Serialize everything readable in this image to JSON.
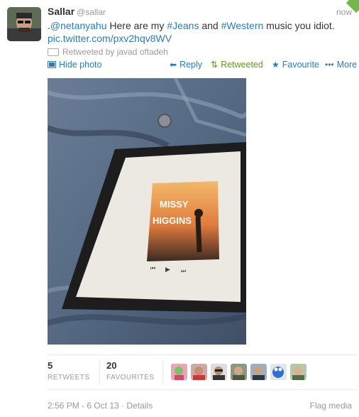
{
  "tweet": {
    "name": "Sallar",
    "handle": "@sallar",
    "time": "now",
    "text": {
      "dot": ".",
      "mention": "@netanyahu",
      "part1": " Here are my ",
      "tag1": "#Jeans",
      "part2": " and ",
      "tag2": "#Western",
      "part3": " music you idiot.",
      "pic_link": "pic.twitter.com/pxv2hqv8WV"
    },
    "retweeted_by": "Retweeted by javad oftadeh"
  },
  "actions": {
    "hide_photo": "Hide photo",
    "reply": "Reply",
    "retweeted": "Retweeted",
    "favourite": "Favourite",
    "more": "More"
  },
  "photo": {
    "album_artist": "MISSY",
    "album_title": "HIGGINS"
  },
  "stats": {
    "retweets_count": "5",
    "retweets_label": "RETWEETS",
    "favourites_count": "20",
    "favourites_label": "FAVOURITES"
  },
  "footer": {
    "timestamp": "2:56 PM - 6 Oct 13",
    "separator": " · ",
    "details": "Details",
    "flag": "Flag media"
  },
  "icons": {
    "reply": "reply-icon",
    "retweet": "retweet-icon",
    "favourite": "star-icon",
    "more": "more-icon",
    "photo": "photo-icon"
  },
  "colors": {
    "link": "#2b7bb9",
    "retweeted": "#609928",
    "muted": "#999999"
  }
}
